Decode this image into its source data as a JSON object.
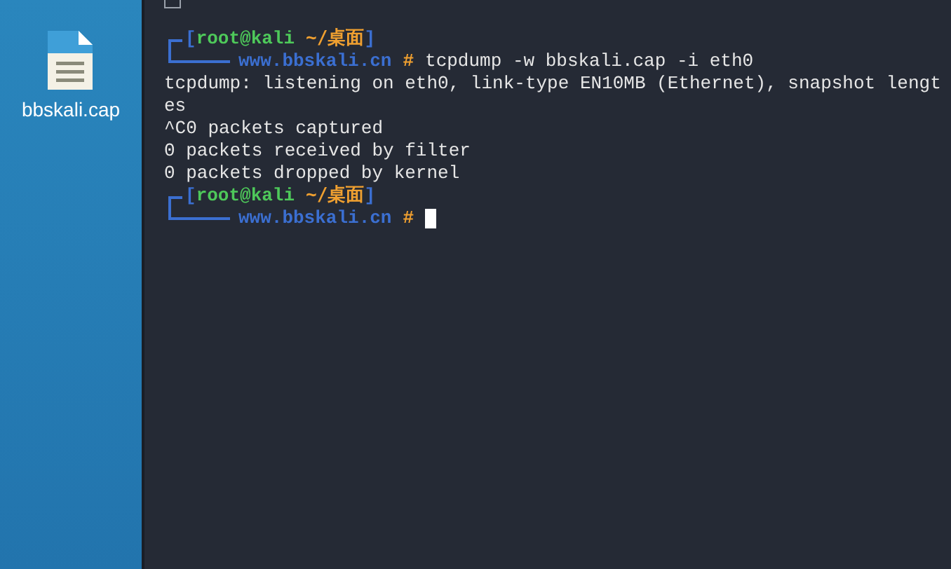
{
  "desktop": {
    "icons": [
      {
        "label": "bbskali.cap"
      }
    ]
  },
  "terminal": {
    "lines": [
      {
        "kind": "prompt_top",
        "user_host": "root@kali",
        "path": "~/桌面",
        "open": "[",
        "close": "]"
      },
      {
        "kind": "prompt_bottom",
        "host": "www.bbskali.cn",
        "symbol": "#",
        "command": "tcpdump -w bbskali.cap -i eth0",
        "cursor": false
      },
      {
        "kind": "output",
        "text": "tcpdump: listening on eth0, link-type EN10MB (Ethernet), snapshot lengt"
      },
      {
        "kind": "output",
        "text": "es"
      },
      {
        "kind": "output",
        "text": "^C0 packets captured"
      },
      {
        "kind": "output",
        "text": "0 packets received by filter"
      },
      {
        "kind": "output",
        "text": "0 packets dropped by kernel"
      },
      {
        "kind": "prompt_top",
        "user_host": "root@kali",
        "path": "~/桌面",
        "open": "[",
        "close": "]"
      },
      {
        "kind": "prompt_bottom",
        "host": "www.bbskali.cn",
        "symbol": "#",
        "cursor": true
      }
    ]
  }
}
